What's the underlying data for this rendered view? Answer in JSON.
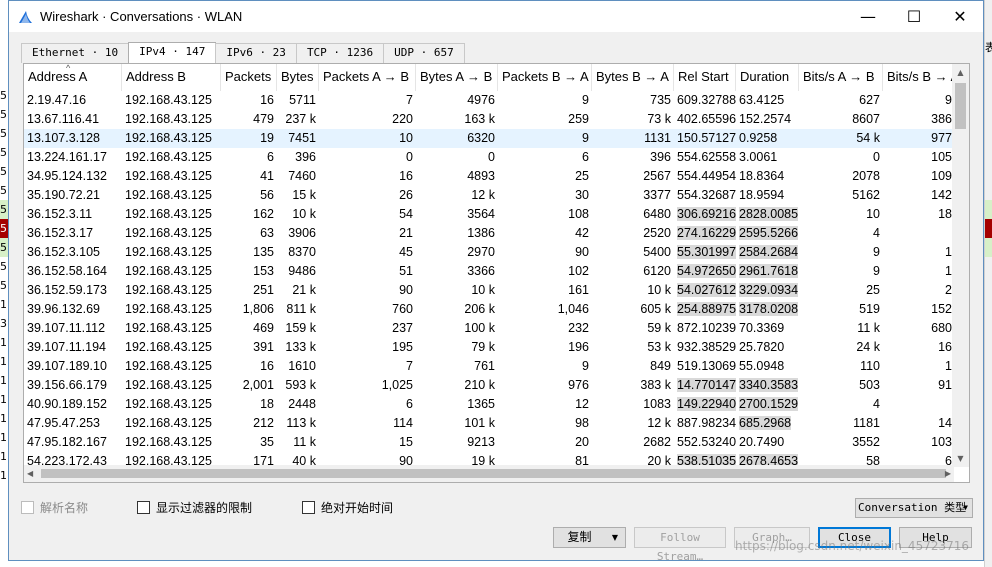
{
  "window": {
    "title": "Wireshark · Conversations · WLAN",
    "controls": {
      "minimize": "—",
      "maximize": "☐",
      "close": "✕"
    }
  },
  "colors": {
    "selected_row": "#e5f3ff",
    "accent": "#0078d7",
    "shark_fin": "#1e6fd9"
  },
  "background": {
    "left_glyphs": [
      "5",
      "5",
      "5",
      "5",
      "5",
      "5",
      "5",
      "5",
      "5",
      "5",
      "5",
      "1",
      "3",
      "1",
      "1",
      "1",
      "1",
      "1",
      "1",
      "1",
      "1"
    ],
    "right_glyph": "表"
  },
  "tabs": [
    {
      "label": "Ethernet · 10",
      "active": false
    },
    {
      "label": "IPv4 · 147",
      "active": true
    },
    {
      "label": "IPv6 · 23",
      "active": false
    },
    {
      "label": "TCP · 1236",
      "active": false
    },
    {
      "label": "UDP · 657",
      "active": false
    }
  ],
  "columns": [
    "Address A",
    "Address B",
    "Packets",
    "Bytes",
    "Packets A → B",
    "Bytes A → B",
    "Packets B → A",
    "Bytes B → A",
    "Rel Start",
    "Duration",
    "Bits/s A → B",
    "Bits/s B → A"
  ],
  "rows": [
    [
      "2.19.47.16",
      "192.168.43.125",
      "16",
      "5711",
      "7",
      "4976",
      "9",
      "735",
      "609.32788",
      "63.4125",
      "627",
      "9"
    ],
    [
      "13.67.116.41",
      "192.168.43.125",
      "479",
      "237 k",
      "220",
      "163 k",
      "259",
      "73 k",
      "402.65596",
      "152.2574",
      "8607",
      "386"
    ],
    [
      "13.107.3.128",
      "192.168.43.125",
      "19",
      "7451",
      "10",
      "6320",
      "9",
      "1131",
      "150.57127",
      "0.9258",
      "54 k",
      "977"
    ],
    [
      "13.224.161.17",
      "192.168.43.125",
      "6",
      "396",
      "0",
      "0",
      "6",
      "396",
      "554.62558",
      "3.0061",
      "0",
      "105"
    ],
    [
      "34.95.124.132",
      "192.168.43.125",
      "41",
      "7460",
      "16",
      "4893",
      "25",
      "2567",
      "554.44954",
      "18.8364",
      "2078",
      "109"
    ],
    [
      "35.190.72.21",
      "192.168.43.125",
      "56",
      "15 k",
      "26",
      "12 k",
      "30",
      "3377",
      "554.32687",
      "18.9594",
      "5162",
      "142"
    ],
    [
      "36.152.3.11",
      "192.168.43.125",
      "162",
      "10 k",
      "54",
      "3564",
      "108",
      "6480",
      "306.692161",
      "2828.0085",
      "10",
      "18"
    ],
    [
      "36.152.3.17",
      "192.168.43.125",
      "63",
      "3906",
      "21",
      "1386",
      "42",
      "2520",
      "274.162293",
      "2595.5266",
      "4",
      ""
    ],
    [
      "36.152.3.105",
      "192.168.43.125",
      "135",
      "8370",
      "45",
      "2970",
      "90",
      "5400",
      "55.301997",
      "2584.2684",
      "9",
      "1"
    ],
    [
      "36.152.58.164",
      "192.168.43.125",
      "153",
      "9486",
      "51",
      "3366",
      "102",
      "6120",
      "54.972650",
      "2961.7618",
      "9",
      "1"
    ],
    [
      "36.152.59.173",
      "192.168.43.125",
      "251",
      "21 k",
      "90",
      "10 k",
      "161",
      "10 k",
      "54.027612",
      "3229.0934",
      "25",
      "2"
    ],
    [
      "39.96.132.69",
      "192.168.43.125",
      "1,806",
      "811 k",
      "760",
      "206 k",
      "1,046",
      "605 k",
      "254.889752",
      "3178.0208",
      "519",
      "152"
    ],
    [
      "39.107.11.112",
      "192.168.43.125",
      "469",
      "159 k",
      "237",
      "100 k",
      "232",
      "59 k",
      "872.10239",
      "70.3369",
      "11 k",
      "680"
    ],
    [
      "39.107.11.194",
      "192.168.43.125",
      "391",
      "133 k",
      "195",
      "79 k",
      "196",
      "53 k",
      "932.38529",
      "25.7820",
      "24 k",
      "16"
    ],
    [
      "39.107.189.10",
      "192.168.43.125",
      "16",
      "1610",
      "7",
      "761",
      "9",
      "849",
      "519.13069",
      "55.0948",
      "110",
      "1"
    ],
    [
      "39.156.66.179",
      "192.168.43.125",
      "2,001",
      "593 k",
      "1,025",
      "210 k",
      "976",
      "383 k",
      "14.770147",
      "3340.3583",
      "503",
      "91"
    ],
    [
      "40.90.189.152",
      "192.168.43.125",
      "18",
      "2448",
      "6",
      "1365",
      "12",
      "1083",
      "149.229408",
      "2700.1529",
      "4",
      ""
    ],
    [
      "47.95.47.253",
      "192.168.43.125",
      "212",
      "113 k",
      "114",
      "101 k",
      "98",
      "12 k",
      "887.98234",
      "685.2968",
      "1181",
      "14"
    ],
    [
      "47.95.182.167",
      "192.168.43.125",
      "35",
      "11 k",
      "15",
      "9213",
      "20",
      "2682",
      "552.53240",
      "20.7490",
      "3552",
      "103"
    ],
    [
      "54.223.172.43",
      "192.168.43.125",
      "171",
      "40 k",
      "90",
      "19 k",
      "81",
      "20 k",
      "538.510356",
      "2678.4653",
      "58",
      "6"
    ]
  ],
  "selected_row": 2,
  "highlight_cells": [
    [
      6,
      8
    ],
    [
      6,
      9
    ],
    [
      7,
      8
    ],
    [
      7,
      9
    ],
    [
      8,
      8
    ],
    [
      8,
      9
    ],
    [
      9,
      8
    ],
    [
      9,
      9
    ],
    [
      10,
      8
    ],
    [
      10,
      9
    ],
    [
      11,
      8
    ],
    [
      11,
      9
    ],
    [
      15,
      8
    ],
    [
      15,
      9
    ],
    [
      16,
      8
    ],
    [
      16,
      9
    ],
    [
      17,
      9
    ],
    [
      19,
      8
    ],
    [
      19,
      9
    ]
  ],
  "options": {
    "resolve_names": "解析名称",
    "limit_filter": "显示过滤器的限制",
    "absolute_time": "绝对开始时间",
    "conversation_type": "Conversation 类型"
  },
  "buttons": {
    "copy": "复制",
    "follow_stream": "Follow Stream…",
    "graph": "Graph…",
    "close": "Close",
    "help": "Help"
  },
  "watermark": "https://blog.csdn.net/weixin_45723716"
}
